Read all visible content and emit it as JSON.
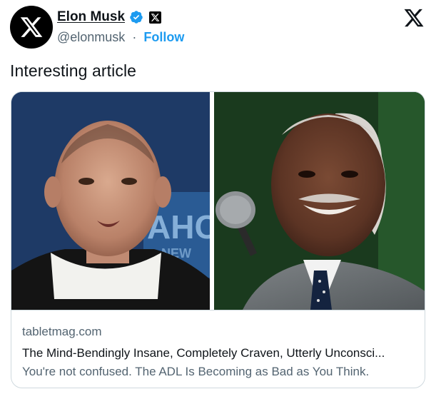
{
  "author": {
    "name": "Elon Musk",
    "handle": "@elonmusk",
    "separator": "·",
    "follow_label": "Follow"
  },
  "icons": {
    "avatar": "x-logo-icon",
    "verified": "verified-badge-icon",
    "affiliation": "x-affiliation-icon",
    "brand": "x-logo-icon"
  },
  "tweet": {
    "text": "Interesting article"
  },
  "card": {
    "domain": "tabletmag.com",
    "title": "The Mind-Bendingly Insane, Completely Craven, Utterly Unconsci...",
    "description": "You're not confused. The ADL Is Becoming as Bad as You Think."
  },
  "colors": {
    "accent": "#1d9bf0",
    "text": "#0f1419",
    "secondary": "#536471",
    "border": "#cfd9de"
  }
}
